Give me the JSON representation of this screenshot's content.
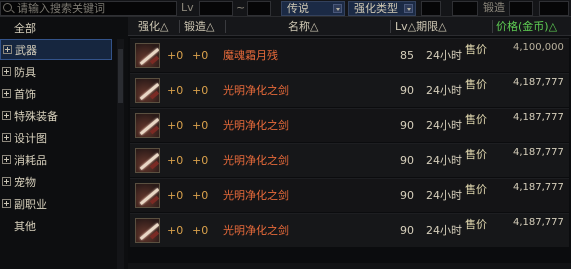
{
  "filters": {
    "search_placeholder": "请输入搜索关键词",
    "level_label": "Lv",
    "level_dash": "~",
    "rarity_select": "传说",
    "enhance_type_select": "强化类型",
    "forge_label": "锻造"
  },
  "sidebar": {
    "items": [
      {
        "label": "全部",
        "expandable": false
      },
      {
        "label": "武器",
        "expandable": true,
        "active": true
      },
      {
        "label": "防具",
        "expandable": true
      },
      {
        "label": "首饰",
        "expandable": true
      },
      {
        "label": "特殊装备",
        "expandable": true
      },
      {
        "label": "设计图",
        "expandable": true
      },
      {
        "label": "消耗品",
        "expandable": true
      },
      {
        "label": "宠物",
        "expandable": true
      },
      {
        "label": "副职业",
        "expandable": true
      },
      {
        "label": "其他",
        "expandable": false
      }
    ]
  },
  "table": {
    "headers": {
      "enhance": "强化△",
      "forge": "锻造△",
      "name": "名称△",
      "level_period": "Lv△期限△",
      "price": "价格(金币)△"
    },
    "rows": [
      {
        "enhance": "+0",
        "forge": "+0",
        "name": "魔魂霜月残",
        "level": "85",
        "duration": "24小时",
        "sell": "售价",
        "price": "4,100,000"
      },
      {
        "enhance": "+0",
        "forge": "+0",
        "name": "光明净化之剑",
        "level": "90",
        "duration": "24小时",
        "sell": "售价",
        "price": "4,187,777"
      },
      {
        "enhance": "+0",
        "forge": "+0",
        "name": "光明净化之剑",
        "level": "90",
        "duration": "24小时",
        "sell": "售价",
        "price": "4,187,777"
      },
      {
        "enhance": "+0",
        "forge": "+0",
        "name": "光明净化之剑",
        "level": "90",
        "duration": "24小时",
        "sell": "售价",
        "price": "4,187,777"
      },
      {
        "enhance": "+0",
        "forge": "+0",
        "name": "光明净化之剑",
        "level": "90",
        "duration": "24小时",
        "sell": "售价",
        "price": "4,187,777"
      },
      {
        "enhance": "+0",
        "forge": "+0",
        "name": "光明净化之剑",
        "level": "90",
        "duration": "24小时",
        "sell": "售价",
        "price": "4,187,777"
      }
    ]
  },
  "colors": {
    "item_name": "#e86a3a",
    "enhance_value": "#d9a14c",
    "price_header": "#5fcf54",
    "active_category": "#16263f"
  },
  "icons": {
    "search": "search-icon",
    "expand": "plus-icon",
    "dropdown": "chevron-down-icon",
    "item": "sword-item-icon"
  }
}
